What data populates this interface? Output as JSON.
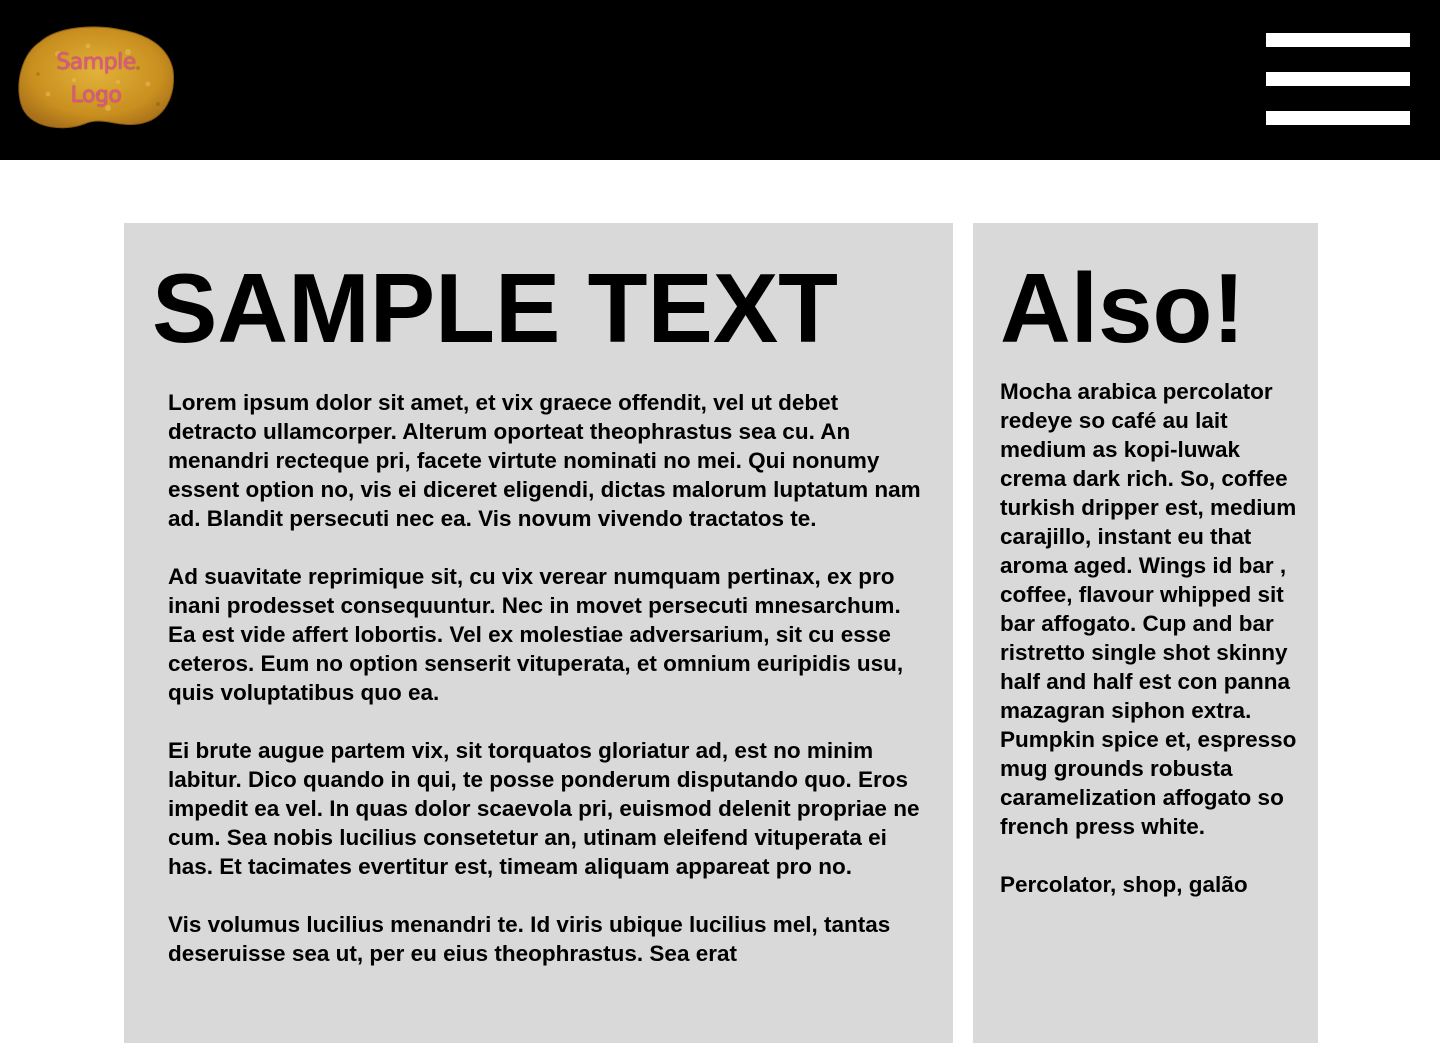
{
  "header": {
    "logo": {
      "line1": "Sample",
      "line2": "Logo"
    },
    "menu_icon": "hamburger-menu-icon"
  },
  "main": {
    "title": "SAMPLE TEXT",
    "paragraphs": [
      "Lorem ipsum dolor sit amet, et vix graece offendit, vel ut debet detracto ullamcorper. Alterum oporteat theophrastus sea cu. An menandri recteque pri, facete virtute nominati no mei. Qui nonumy essent option no, vis ei diceret eligendi, dictas malorum luptatum nam ad. Blandit persecuti nec ea. Vis novum vivendo tractatos te.",
      "Ad suavitate reprimique sit, cu vix verear numquam pertinax, ex pro inani prodesset consequuntur. Nec in movet persecuti mnesarchum. Ea est vide affert lobortis. Vel ex molestiae adversarium, sit cu esse ceteros. Eum no option senserit vituperata, et omnium euripidis usu, quis voluptatibus quo ea.",
      "Ei brute augue partem vix, sit torquatos gloriatur ad, est no minim labitur. Dico quando in qui, te posse ponderum disputando quo. Eros impedit ea vel. In quas dolor scaevola pri, euismod delenit propriae ne cum. Sea nobis lucilius consetetur an, utinam eleifend vituperata ei has. Et tacimates evertitur est, timeam aliquam appareat pro no.",
      "Vis volumus lucilius menandri te. Id viris ubique lucilius mel, tantas deseruisse sea ut, per eu eius theophrastus. Sea erat"
    ]
  },
  "sidebar": {
    "title": "Also!",
    "paragraphs": [
      "Mocha arabica percolator redeye so café au lait medium as kopi-luwak crema dark rich. So, coffee turkish dripper est, medium carajillo, instant eu that aroma aged. Wings id bar , coffee, flavour whipped sit bar affogato. Cup and bar ristretto single shot skinny half and half est con panna mazagran siphon extra. Pumpkin spice et, espresso mug grounds robusta caramelization affogato so french press white.",
      "Percolator, shop, galão"
    ]
  },
  "colors": {
    "header_bg": "#000000",
    "panel_bg": "#d9d9d9",
    "logo_fill": "#d9a62a",
    "logo_text": "#e0568c"
  }
}
